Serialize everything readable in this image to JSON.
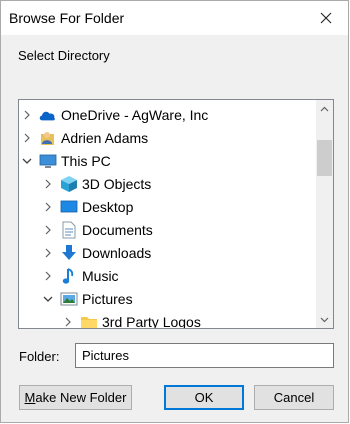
{
  "window": {
    "title": "Browse For Folder"
  },
  "instruction": "Select Directory",
  "tree": {
    "items": [
      {
        "label": "OneDrive - AgWare, Inc",
        "icon": "onedrive-cloud-icon",
        "expand": "collapsed"
      },
      {
        "label": "Adrien Adams",
        "icon": "user-folder-icon",
        "expand": "collapsed"
      },
      {
        "label": "This PC",
        "icon": "computer-icon",
        "expand": "expanded"
      },
      {
        "label": "3D Objects",
        "icon": "3d-objects-icon",
        "expand": "collapsed"
      },
      {
        "label": "Desktop",
        "icon": "desktop-icon",
        "expand": "collapsed"
      },
      {
        "label": "Documents",
        "icon": "documents-icon",
        "expand": "collapsed"
      },
      {
        "label": "Downloads",
        "icon": "downloads-icon",
        "expand": "collapsed"
      },
      {
        "label": "Music",
        "icon": "music-icon",
        "expand": "collapsed"
      },
      {
        "label": "Pictures",
        "icon": "pictures-icon",
        "expand": "expanded"
      },
      {
        "label": "3rd Party Logos",
        "icon": "folder-icon",
        "expand": "collapsed"
      }
    ]
  },
  "folder": {
    "label": "Folder:",
    "value": "Pictures"
  },
  "buttons": {
    "new_folder_prefix": "M",
    "new_folder_rest": "ake New Folder",
    "ok": "OK",
    "cancel": "Cancel"
  },
  "colors": {
    "accent": "#0078d7",
    "dialog_bg": "#f0f0f0",
    "button_bg": "#e1e1e1"
  }
}
